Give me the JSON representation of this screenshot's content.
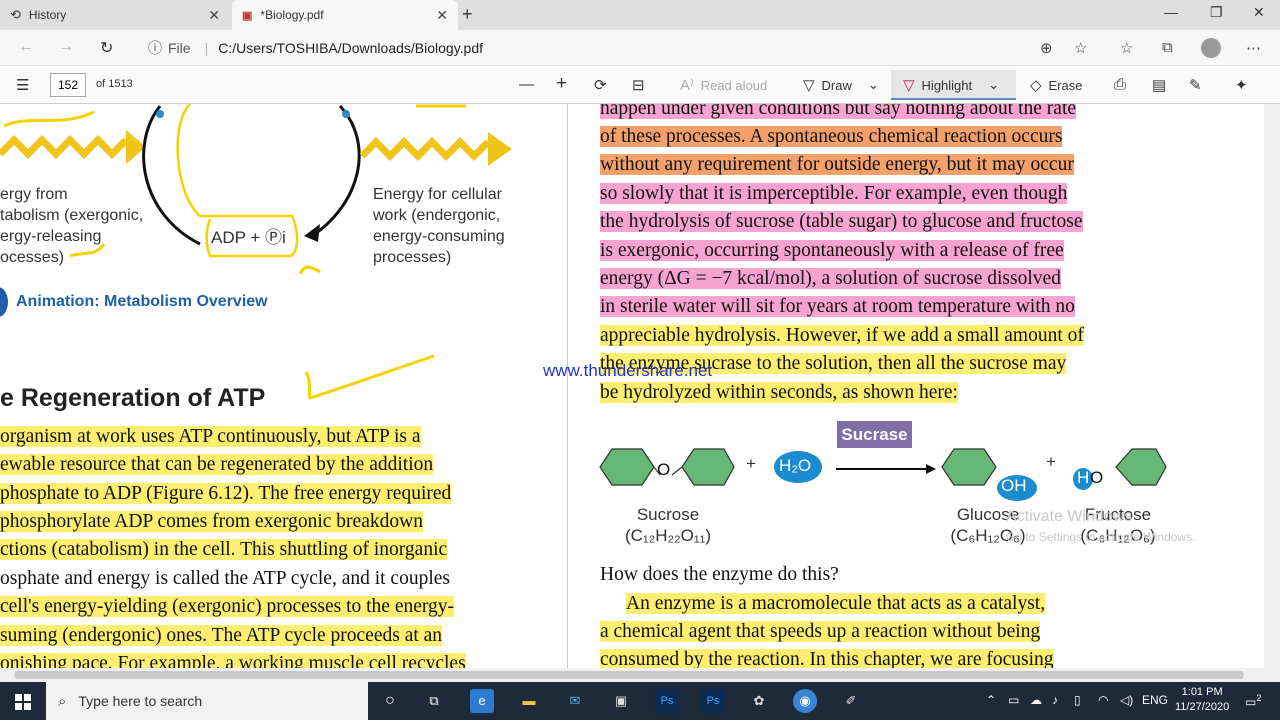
{
  "tabs": [
    {
      "title": "History",
      "icon": "history-icon"
    },
    {
      "title": "*Biology.pdf",
      "icon": "pdf-icon"
    }
  ],
  "address": {
    "info": "ⓘ",
    "scheme_label": "File",
    "url": "C:/Users/TOSHIBA/Downloads/Biology.pdf"
  },
  "pdf_toolbar": {
    "page_current": "152",
    "page_total": "of 1513",
    "read_aloud": "Read aloud",
    "draw": "Draw",
    "highlight": "Highlight",
    "erase": "Erase"
  },
  "left": {
    "diagram_left_label": [
      "ergy from",
      "tabolism (exergonic,",
      "ergy-releasing",
      "ocesses)"
    ],
    "diagram_mid_label": "ADP + Ⓟi",
    "diagram_right_label": [
      "Energy for cellular",
      "work (endergonic,",
      "energy-consuming",
      "processes)"
    ],
    "animation": "Animation: Metabolism Overview",
    "heading": "e Regeneration of ATP",
    "lines": [
      "organism at work uses ATP continuously, but ATP is a",
      "ewable resource that can be regenerated by the addition",
      "phosphate to ADP (Figure 6.12). The free energy required",
      "phosphorylate ADP comes from exergonic breakdown",
      "ctions (catabolism) in the cell. This shuttling of inorganic",
      "osphate and energy is called the ATP cycle, and it couples",
      " cell's energy-yielding (exergonic) processes to the energy-",
      "suming (endergonic) ones. The ATP cycle proceeds at an",
      "onishing pace. For example, a working muscle cell recycles"
    ]
  },
  "right": {
    "lines": [
      "happen under given conditions but say nothing about the rate",
      "of these processes. A spontaneous chemical reaction occurs",
      "without any requirement for outside energy, but it may occur",
      "so slowly that it is imperceptible. For example, even though",
      "the hydrolysis of sucrose (table sugar) to glucose and fructose",
      "is exergonic, occurring spontaneously with a release of free",
      "energy (ΔG = −7 kcal/mol), a solution of sucrose dissolved",
      "in sterile water will sit for years at room temperature with no",
      "appreciable hydrolysis. However, if we add a small amount of",
      "the enzyme sucrase to the solution, then all the sucrose may",
      "be hydrolyzed within seconds, as shown here:"
    ],
    "watermark": "www.thundershare.net",
    "enzyme": "Sucrase",
    "water": "H₂O",
    "oh": "OH",
    "ho_h": "H",
    "ho_o": "O",
    "o": "O",
    "plus": "+",
    "sucrose": "Sucrose",
    "sucrose_formula": "(C₁₂H₂₂O₁₁)",
    "glucose": "Glucose",
    "glucose_formula": "(C₆H₁₂O₆)",
    "fructose": "Fructose",
    "fructose_formula": "(C₆H₁₂O₆)",
    "question": "How does the enzyme do this?",
    "para2": [
      "An enzyme is a macromolecule that acts as a catalyst,",
      "a chemical agent that speeds up a reaction without being",
      "consumed by the reaction. In this chapter, we are focusing"
    ],
    "activate1": "Activate Windows",
    "activate2": "Go to Settings to activate Windows."
  },
  "taskbar": {
    "search_placeholder": "Type here to search",
    "lang": "ENG",
    "time": "1:01 PM",
    "date": "11/27/2020",
    "notif_count": "2"
  }
}
